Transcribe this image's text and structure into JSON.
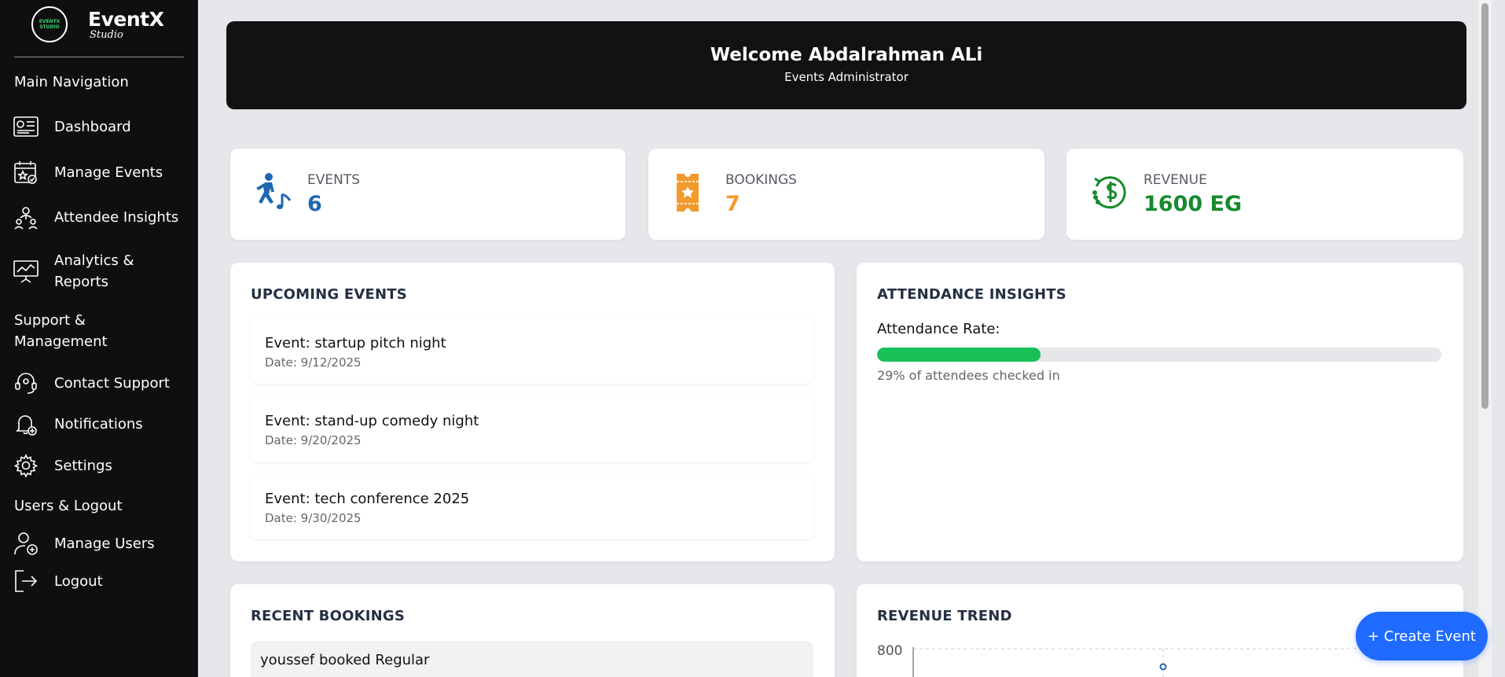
{
  "brand": {
    "logo_lines": [
      "EVENTX",
      "STUDIO"
    ],
    "name": "EventX",
    "tagline": "Studio"
  },
  "sidebar": {
    "sections": {
      "main": "Main Navigation",
      "support": "Support & Management",
      "users": "Users & Logout"
    },
    "items": [
      {
        "label": "Dashboard",
        "icon": "dashboard-icon"
      },
      {
        "label": "Manage Events",
        "icon": "calendar-star-icon"
      },
      {
        "label": "Attendee Insights",
        "icon": "attendees-icon"
      },
      {
        "label": "Analytics & Reports",
        "icon": "presentation-chart-icon"
      },
      {
        "label": "Contact Support",
        "icon": "support-headset-icon"
      },
      {
        "label": "Notifications",
        "icon": "bell-icon"
      },
      {
        "label": "Settings",
        "icon": "gear-icon"
      },
      {
        "label": "Manage Users",
        "icon": "user-add-icon"
      },
      {
        "label": "Logout",
        "icon": "logout-icon"
      }
    ]
  },
  "hero": {
    "title": "Welcome Abdalrahman ALi",
    "subtitle": "Events Administrator"
  },
  "stats": [
    {
      "label": "EVENTS",
      "value": "6",
      "color": "#1f67b0",
      "icon": "dancer-music-icon"
    },
    {
      "label": "BOOKINGS",
      "value": "7",
      "color": "#f29a2e",
      "icon": "ticket-star-icon"
    },
    {
      "label": "REVENUE",
      "value": "1600 EG",
      "color": "#178a2e",
      "icon": "dollar-cycle-icon"
    }
  ],
  "upcoming": {
    "title": "UPCOMING EVENTS",
    "events": [
      {
        "name": "Event: startup pitch night",
        "date": "Date: 9/12/2025"
      },
      {
        "name": "Event: stand-up comedy night",
        "date": "Date: 9/20/2025"
      },
      {
        "name": "Event: tech conference 2025",
        "date": "Date: 9/30/2025"
      }
    ]
  },
  "attendance": {
    "title": "ATTENDANCE INSIGHTS",
    "rate_label": "Attendance Rate:",
    "rate_percent": 29,
    "rate_text": "29% of attendees checked in"
  },
  "recent_bookings": {
    "title": "RECENT BOOKINGS",
    "items": [
      {
        "text": "youssef booked Regular"
      }
    ]
  },
  "revenue_trend": {
    "title": "REVENUE TREND",
    "y_tick_top": "800"
  },
  "actions": {
    "create_event": "+ Create Event"
  },
  "colors": {
    "accent": "#1f6bff",
    "progress": "#18c157",
    "sidebar_bg": "#0f0f10"
  }
}
